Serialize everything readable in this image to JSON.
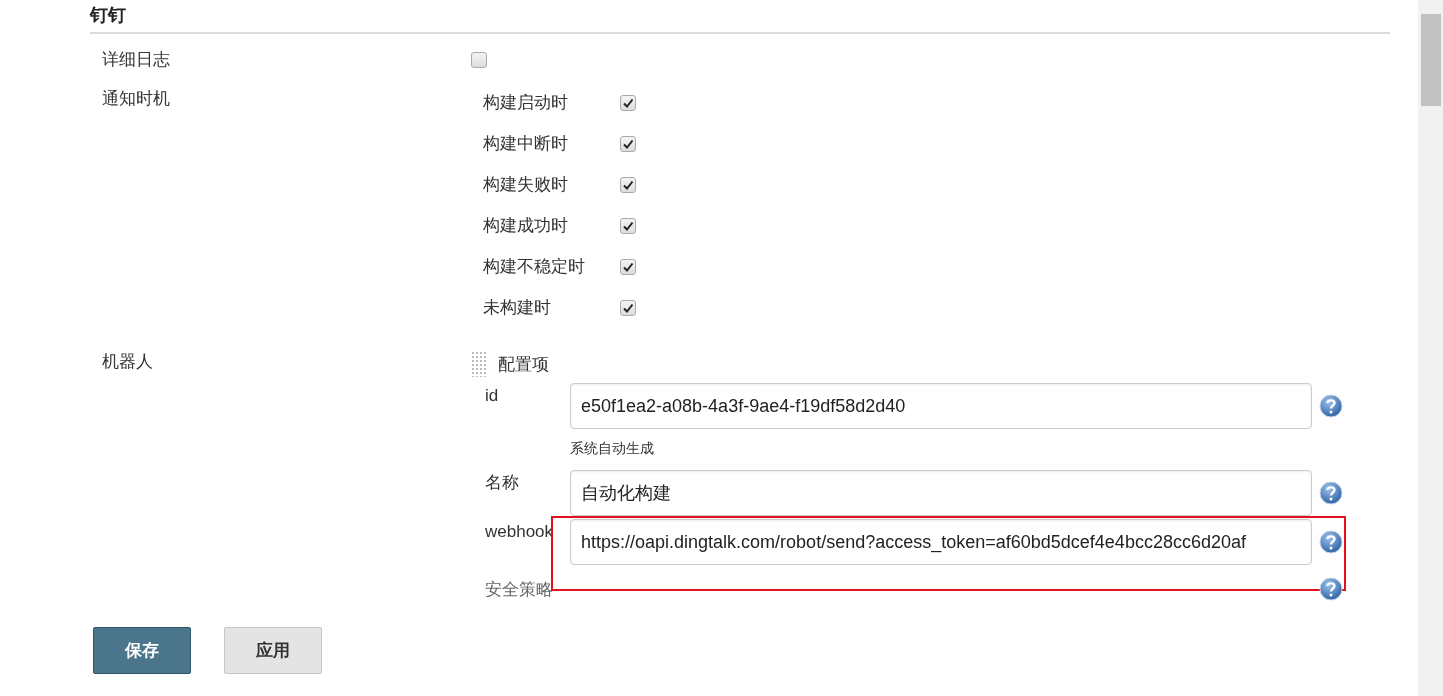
{
  "section": {
    "title": "钉钉"
  },
  "verbose_log": {
    "label": "详细日志",
    "checked": false
  },
  "notify": {
    "label": "通知时机",
    "options": [
      {
        "label": "构建启动时",
        "checked": true
      },
      {
        "label": "构建中断时",
        "checked": true
      },
      {
        "label": "构建失败时",
        "checked": true
      },
      {
        "label": "构建成功时",
        "checked": true
      },
      {
        "label": "构建不稳定时",
        "checked": true
      },
      {
        "label": "未构建时",
        "checked": true
      }
    ]
  },
  "robot": {
    "label": "机器人",
    "item_title": "配置项",
    "fields": [
      {
        "kind": "input",
        "label": "id",
        "value": "e50f1ea2-a08b-4a3f-9ae4-f19df58d2d40",
        "hint": "系统自动生成",
        "highlighted": false
      },
      {
        "kind": "input",
        "label": "名称",
        "value": "自动化构建",
        "highlighted": false
      },
      {
        "kind": "input",
        "label": "webhook",
        "value": "https://oapi.dingtalk.com/robot/send?access_token=af60bd5dcef4e4bcc28cc6d20af",
        "highlighted": true
      },
      {
        "kind": "label",
        "label": "安全策略",
        "highlighted": false
      }
    ]
  },
  "buttons": [
    {
      "label": "保存",
      "kind": "primary"
    },
    {
      "label": "应用",
      "kind": "secondary"
    }
  ]
}
